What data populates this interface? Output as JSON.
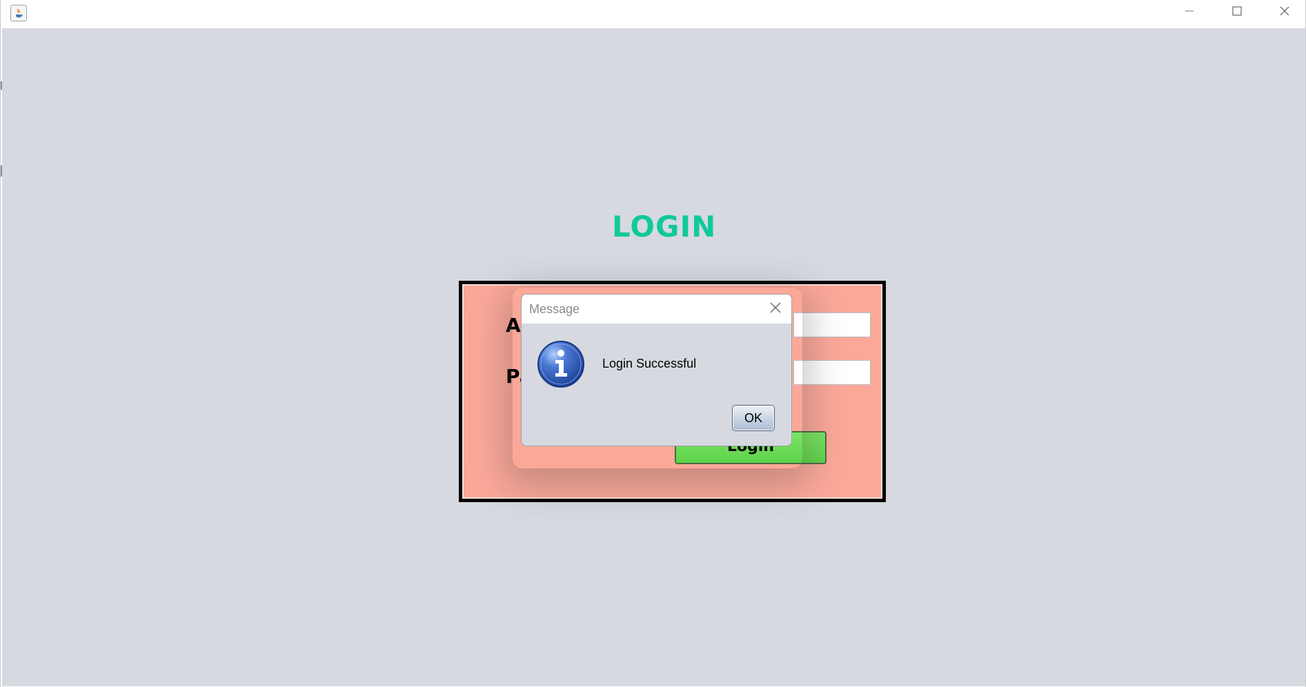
{
  "window": {
    "app_icon": "java-icon",
    "controls": {
      "minimize": "minimize-icon",
      "maximize": "maximize-icon",
      "close": "close-icon"
    }
  },
  "login_form": {
    "title": "LOGIN",
    "account_label_visible": "A",
    "password_label_visible": "Pa",
    "account_value": "",
    "password_value": "",
    "login_button_visible": "Login"
  },
  "dialog": {
    "title": "Message",
    "message": "Login Successful",
    "ok_label": "OK",
    "icon": "information-icon",
    "close_icon": "close-icon"
  },
  "colors": {
    "background": "#d6d9e0",
    "title": "#11c99a",
    "panel": "#fba899",
    "login_button": "#6bdc55"
  }
}
